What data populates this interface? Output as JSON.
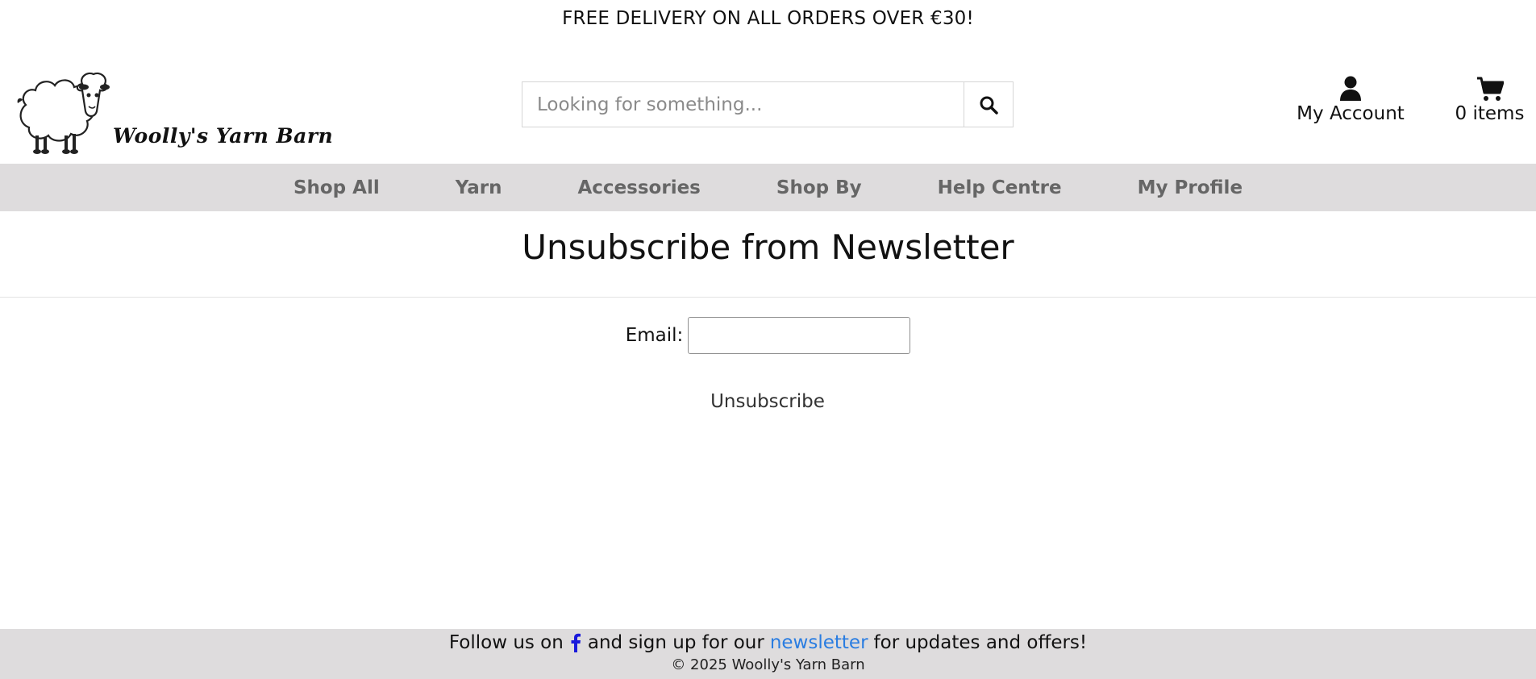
{
  "promo": {
    "text": "FREE DELIVERY ON ALL ORDERS OVER €30!"
  },
  "header": {
    "logo_text": "Woolly's Yarn Barn",
    "search_placeholder": "Looking for something...",
    "search_icon": "search-icon",
    "account_label": "My Account",
    "account_icon": "user-icon",
    "cart_label": "0 items",
    "cart_icon": "cart-icon"
  },
  "nav": {
    "items": [
      {
        "label": "Shop All"
      },
      {
        "label": "Yarn"
      },
      {
        "label": "Accessories"
      },
      {
        "label": "Shop By"
      },
      {
        "label": "Help Centre"
      },
      {
        "label": "My Profile"
      }
    ]
  },
  "main": {
    "title": "Unsubscribe from Newsletter",
    "email_label": "Email:",
    "email_value": "",
    "unsubscribe_label": "Unsubscribe"
  },
  "footer": {
    "follow_prefix": "Follow us on",
    "follow_middle": "and sign up for our",
    "newsletter_link": "newsletter",
    "follow_suffix": "for updates and offers!",
    "copyright": "© 2025 Woolly's Yarn Barn"
  },
  "colors": {
    "nav_bg": "#dedcdd",
    "footer_bg": "#dedcdd",
    "link": "#2a7de1",
    "facebook": "#1a1adb"
  }
}
